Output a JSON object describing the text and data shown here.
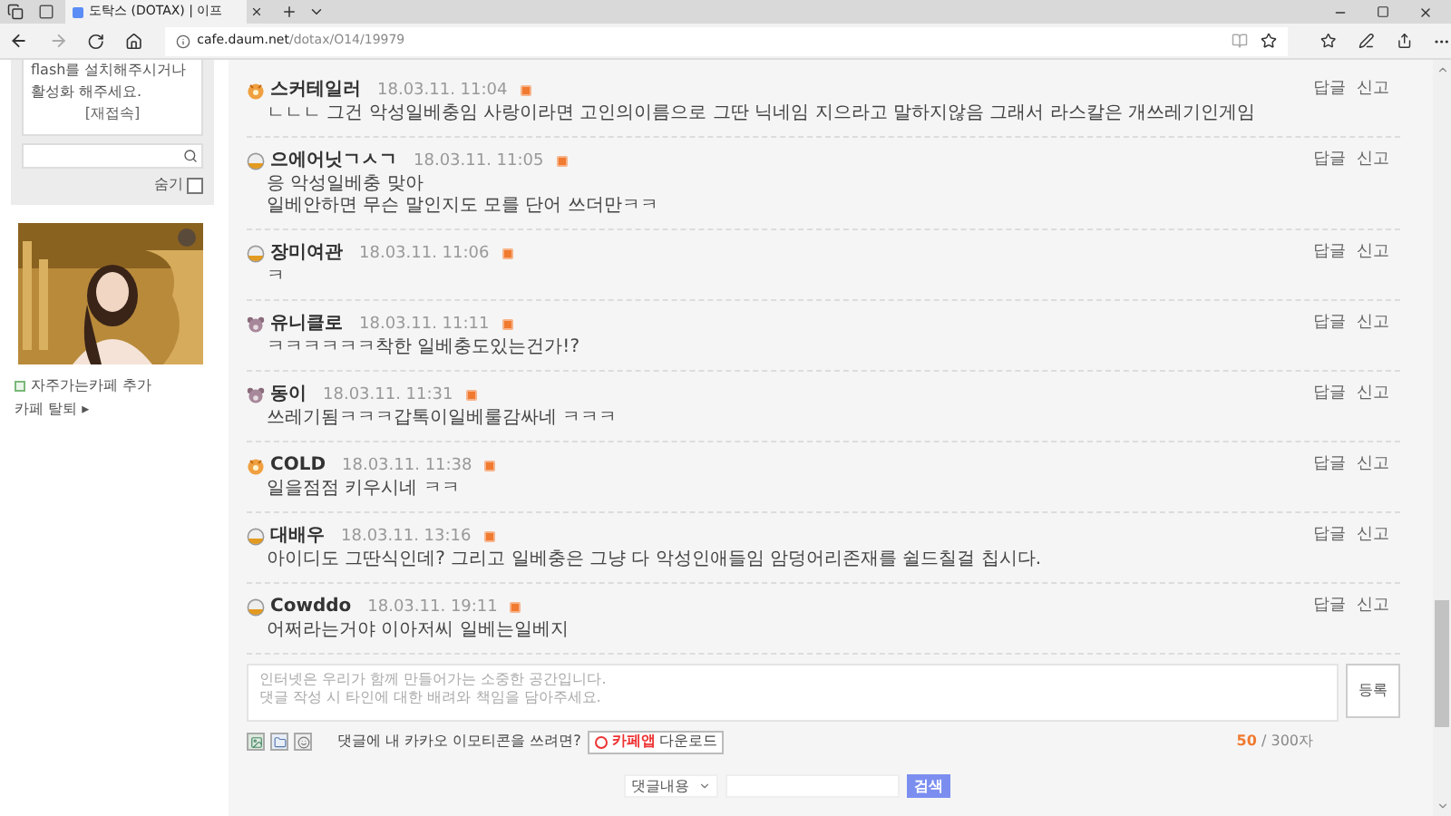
{
  "browser": {
    "tab_title": "도탁스 (DOTAX) | 이프",
    "url_host": "cafe.daum.net",
    "url_path": "/dotax/O14/19979"
  },
  "sidebar": {
    "flash_notice": [
      "flash를 설치해주시거나",
      "활성화 해주세요."
    ],
    "reconnect": "[재접속]",
    "hide_label": "숨기",
    "hide_checked": false,
    "add_favorite": "자주가는카페 추가",
    "leave_cafe": "카페 탈퇴 ▸"
  },
  "comments": [
    {
      "kind": "orange",
      "nick": "스커테일러",
      "time": "18.03.11. 11:04",
      "lines": [
        "ㄴㄴㄴ 그건 악성일베충임 사랑이라면 고인의이름으로 그딴 닉네임 지으라고 말하지않음 그래서 라스칼은 개쓰레기인게임"
      ],
      "actions": [
        "답글",
        "신고"
      ]
    },
    {
      "kind": "bowl",
      "nick": "으에어닛ㄱㅅㄱ",
      "time": "18.03.11. 11:05",
      "lines": [
        "응 악성일베충 맞아",
        "일베안하면 무슨 말인지도 모를 단어 쓰더만ㅋㅋ"
      ],
      "actions": [
        "답글",
        "신고"
      ]
    },
    {
      "kind": "bowl",
      "nick": "장미여관",
      "time": "18.03.11. 11:06",
      "lines": [
        "ㅋ"
      ],
      "actions": [
        "답글",
        "신고"
      ]
    },
    {
      "kind": "bear",
      "nick": "유니클로",
      "time": "18.03.11. 11:11",
      "lines": [
        "ㅋㅋㅋㅋㅋㅋ착한 일베충도있는건가!?"
      ],
      "actions": [
        "답글",
        "신고"
      ]
    },
    {
      "kind": "bear",
      "nick": "동이",
      "time": "18.03.11. 11:31",
      "lines": [
        "쓰레기됨ㅋㅋㅋ갑톡이일베룰감싸네 ㅋㅋㅋ"
      ],
      "actions": [
        "답글",
        "신고"
      ]
    },
    {
      "kind": "orange",
      "nick": "COLD",
      "time": "18.03.11. 11:38",
      "lines": [
        "일을점점 키우시네 ㅋㅋ"
      ],
      "actions": [
        "답글",
        "신고"
      ]
    },
    {
      "kind": "bowl",
      "nick": "대배우",
      "time": "18.03.11. 13:16",
      "lines": [
        "아이디도 그딴식인데? 그리고 일베충은 그냥 다 악성인애들임 암덩어리존재를 쉴드칠걸 칩시다."
      ],
      "actions": [
        "답글",
        "신고"
      ]
    },
    {
      "kind": "bowl",
      "nick": "Cowddo",
      "time": "18.03.11. 19:11",
      "lines": [
        "어쩌라는거야 이아저씨 일베는일베지"
      ],
      "actions": [
        "답글",
        "신고"
      ]
    }
  ],
  "comment_form": {
    "placeholder": "인터넷은 우리가 함께 만들어가는 소중한 공간입니다.\n댓글 작성 시 타인에 대한 배려와 책임을 담아주세요.",
    "submit": "등록",
    "emoticon_prompt": "댓글에 내 카카오 이모티콘을 쓰려면?",
    "app_name": "카페앱",
    "app_download": "다운로드",
    "count": "50",
    "limit": "/ 300자"
  },
  "search": {
    "scope": "댓글내용",
    "button": "검색"
  }
}
